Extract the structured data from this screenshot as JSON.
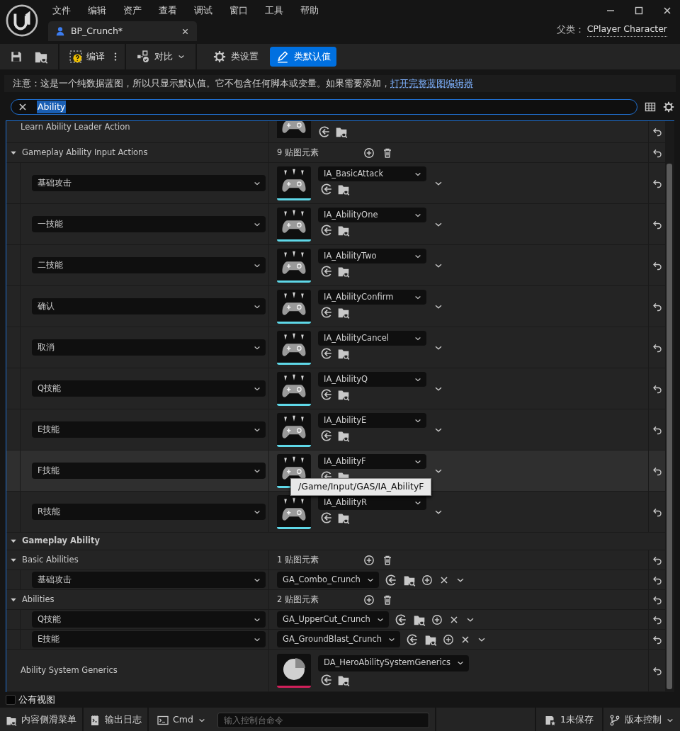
{
  "menu": [
    "文件",
    "编辑",
    "资产",
    "查看",
    "调试",
    "窗口",
    "工具",
    "帮助"
  ],
  "document_tab": {
    "title": "BP_Crunch*"
  },
  "parent_class": {
    "label": "父类：",
    "value": "CPlayer Character"
  },
  "toolbar": {
    "compile": "编译",
    "diff": "对比",
    "modes": [
      {
        "label": "类设置",
        "selected": false
      },
      {
        "label": "类默认值",
        "selected": true
      }
    ]
  },
  "notice": {
    "text": "注意：这是一个纯数据蓝图，所以只显示默认值。它不包含任何脚本或变量。如果需要添加，",
    "link": "打开完整蓝图编辑器"
  },
  "search": {
    "value": "Ability"
  },
  "details": {
    "leader_action": {
      "label": "Learn Ability Leader Action"
    },
    "input_actions": {
      "title": "Gameplay Ability Input Actions",
      "expanded": true,
      "count": "9 贴图元素",
      "rows": [
        {
          "key": "基础攻击",
          "action": "IA_BasicAttack",
          "highlighted": false
        },
        {
          "key": "一技能",
          "action": "IA_AbilityOne",
          "highlighted": false
        },
        {
          "key": "二技能",
          "action": "IA_AbilityTwo",
          "highlighted": false
        },
        {
          "key": "确认",
          "action": "IA_AbilityConfirm",
          "highlighted": false
        },
        {
          "key": "取消",
          "action": "IA_AbilityCancel",
          "highlighted": false
        },
        {
          "key": "Q技能",
          "action": "IA_AbilityQ",
          "highlighted": false
        },
        {
          "key": "E技能",
          "action": "IA_AbilityE",
          "highlighted": false
        },
        {
          "key": "F技能",
          "action": "IA_AbilityF",
          "highlighted": true
        },
        {
          "key": "R技能",
          "action": "IA_AbilityR",
          "highlighted": false
        }
      ]
    },
    "tooltip": "/Game/Input/GAS/IA_AbilityF",
    "gameplay_ability": {
      "title": "Gameplay Ability",
      "expanded": true,
      "groups": [
        {
          "title": "Basic Abilities",
          "expanded": true,
          "count": "1 贴图元素",
          "rows": [
            {
              "key": "基础攻击",
              "ability": "GA_Combo_Crunch"
            }
          ]
        },
        {
          "title": "Abilities",
          "expanded": true,
          "count": "2 贴图元素",
          "rows": [
            {
              "key": "Q技能",
              "ability": "GA_UpperCut_Crunch"
            },
            {
              "key": "E技能",
              "ability": "GA_GroundBlast_Crunch"
            }
          ]
        }
      ],
      "generics": {
        "label": "Ability System Generics",
        "value": "DA_HeroAbilitySystemGenerics"
      }
    }
  },
  "public_view": {
    "label": "公有视图",
    "checked": false
  },
  "status_bar": {
    "content_drawer": "内容侧滑菜单",
    "output_log": "输出日志",
    "cmd": "Cmd",
    "console_placeholder": "输入控制台命令",
    "unsaved": "1未保存",
    "source_control": "版本控制"
  }
}
